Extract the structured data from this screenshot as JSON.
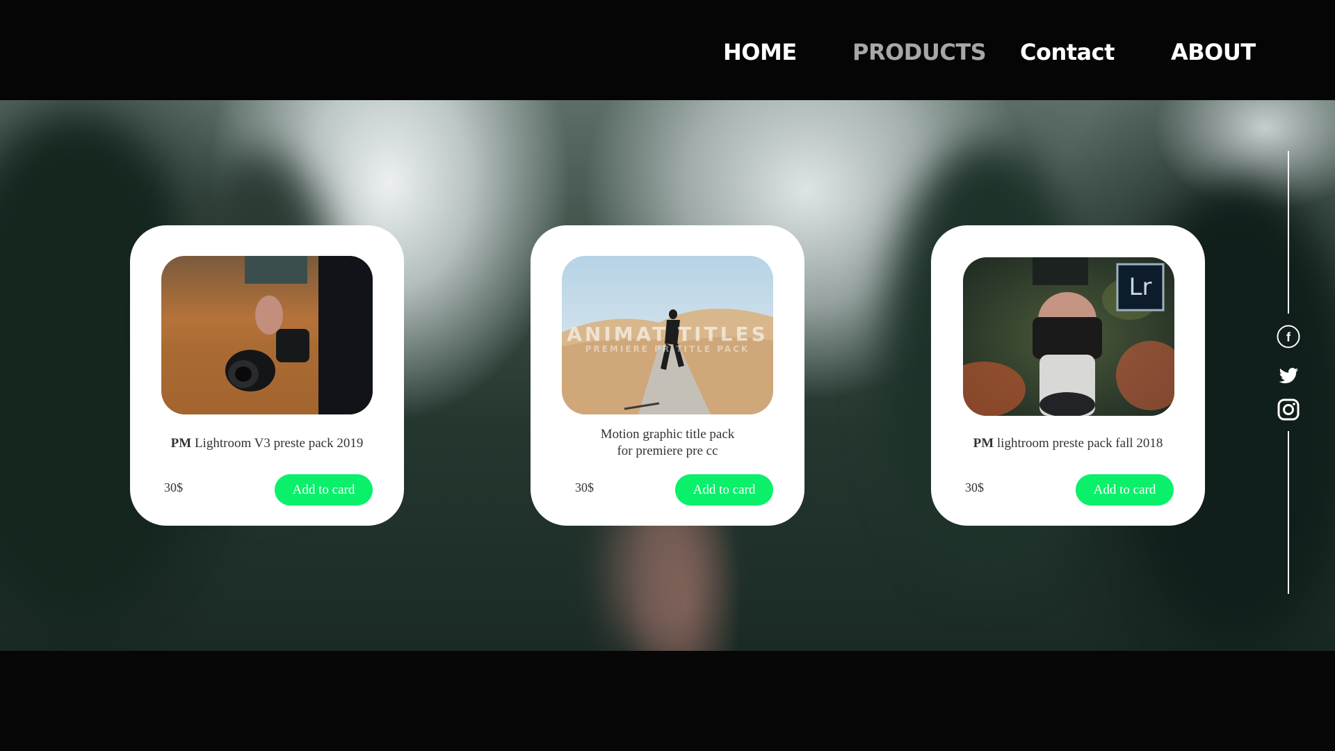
{
  "nav": {
    "home": "HOME",
    "products": "PRODUCTS",
    "contact": "Contact",
    "about": "ABOUT"
  },
  "products": [
    {
      "brand": "PM",
      "name": "Lightroom V3 preste pack 2019",
      "price": "30$",
      "button": "Add to card"
    },
    {
      "line1": "Motion graphic title pack",
      "line2": "for premiere pre cc",
      "price": "30$",
      "button": "Add to card",
      "image_text": {
        "title": "ANIMAT TITLES",
        "subtitle": "PREMIERE PR TITLE PACK"
      }
    },
    {
      "brand": "PM",
      "name": "lightroom preste pack fall 2018",
      "price": "30$",
      "button": "Add to card",
      "badge": "Lr"
    }
  ],
  "social": {
    "facebook": "f"
  },
  "colors": {
    "accent": "#0af06a",
    "nav_active": "#a7a7a7",
    "background": "#050505",
    "card": "#ffffff"
  }
}
